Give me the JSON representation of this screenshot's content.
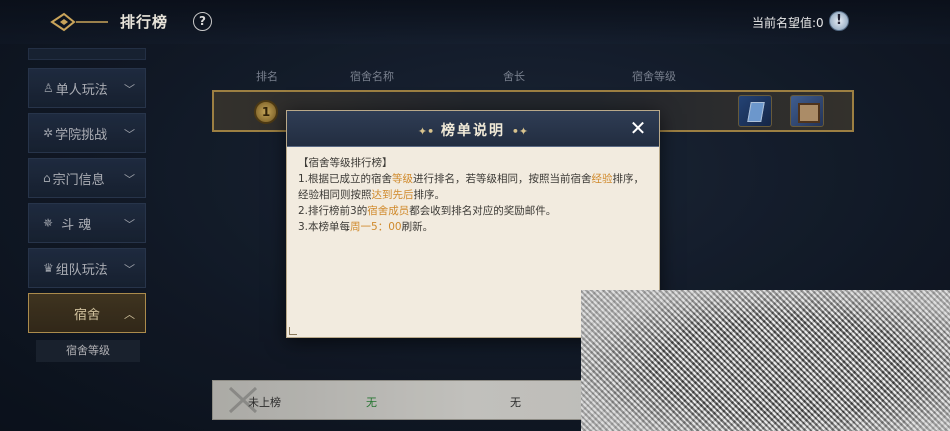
{
  "header": {
    "title": "排行榜",
    "help_icon": "?",
    "prestige_label": "当前名望值:0",
    "prestige_icon": "!"
  },
  "sidebar": {
    "items": [
      {
        "label": "单人玩法",
        "icon": "person-icon"
      },
      {
        "label": "学院挑战",
        "icon": "academy-icon"
      },
      {
        "label": "宗门信息",
        "icon": "sect-icon"
      },
      {
        "label": "斗 魂",
        "icon": "soul-icon"
      },
      {
        "label": "组队玩法",
        "icon": "team-icon"
      },
      {
        "label": "宿舍",
        "icon": ""
      }
    ],
    "sub_item": "宿舍等级"
  },
  "table": {
    "headers": [
      "排名",
      "宿舍名称",
      "舍长",
      "宿舍等级"
    ],
    "top_row": {
      "rank": "1"
    }
  },
  "my_rank": {
    "rank": "未上榜",
    "dorm": "无",
    "leader": "无"
  },
  "modal": {
    "title": "榜单说明",
    "body": {
      "heading": "【宿舍等级排行榜】",
      "l1_a": "1.根据已成立的宿舍",
      "l1_b": "等级",
      "l1_c": "进行排名，若等级相同，按照当前宿舍",
      "l1_d": "经验",
      "l1_e": "排序，经验相同则按照",
      "l1_f": "达到先后",
      "l1_g": "排序。",
      "l2_a": "2.排行榜前3的",
      "l2_b": "宿舍成员",
      "l2_c": "都会收到排名对应的奖励邮件。",
      "l3_a": "3.本榜单每",
      "l3_b": "周一5：00",
      "l3_c": "刷新。"
    }
  }
}
